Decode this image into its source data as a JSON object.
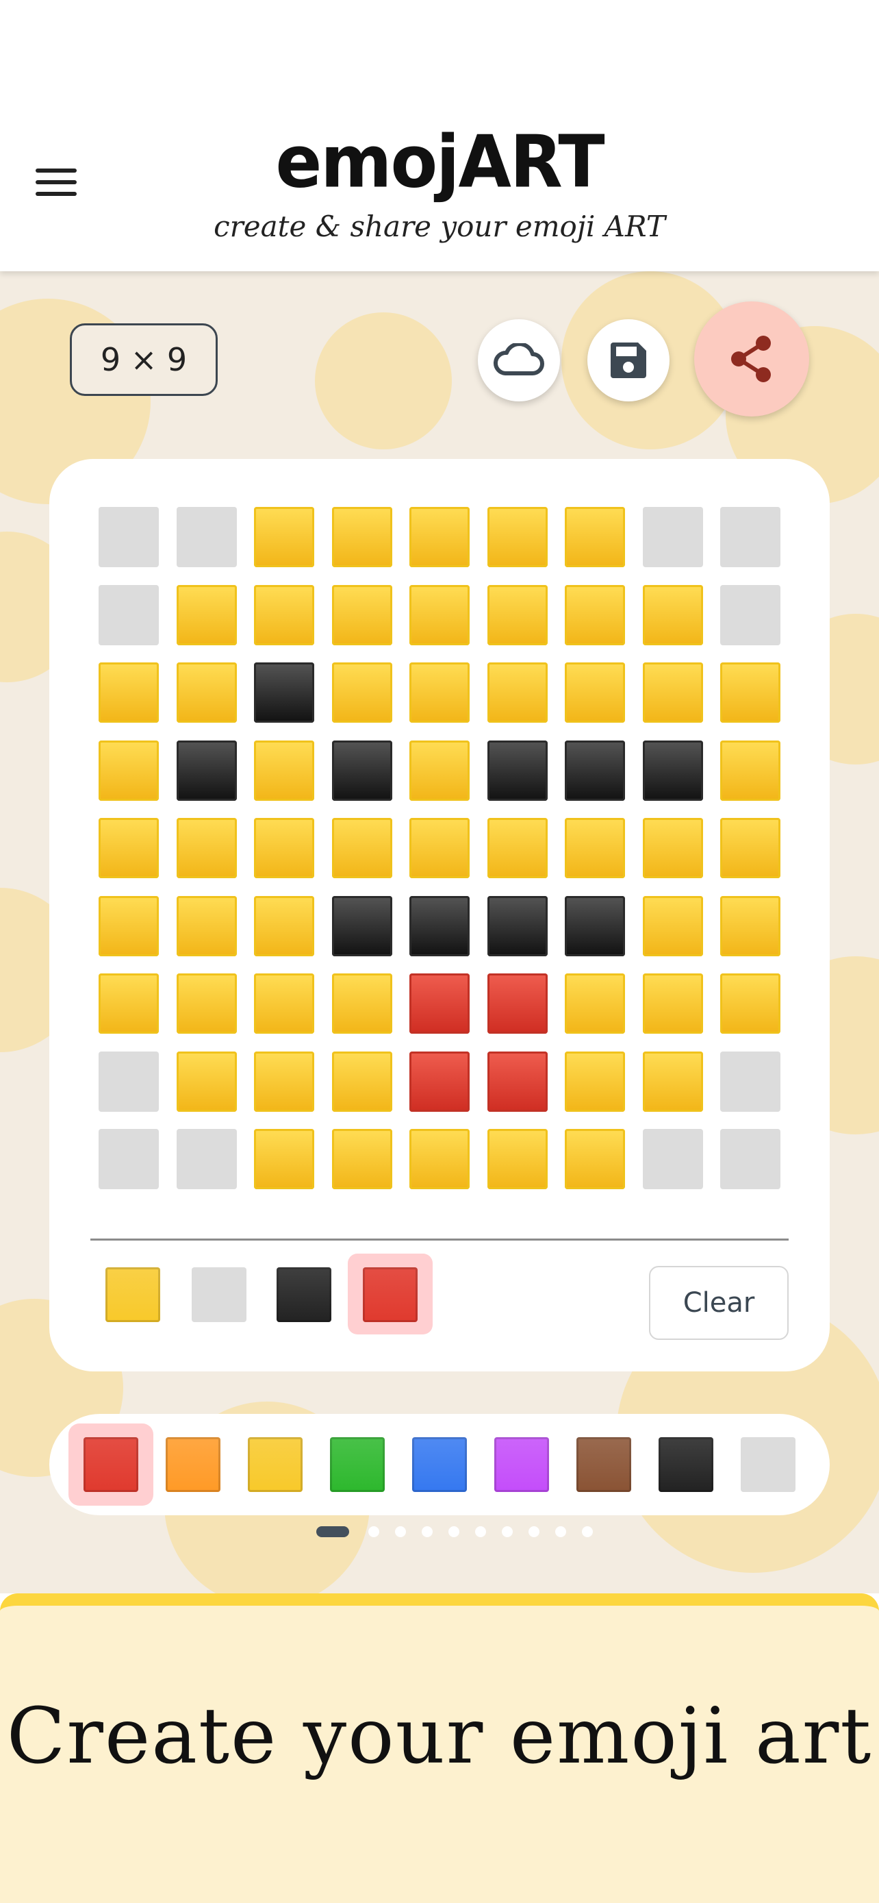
{
  "header": {
    "title": "emojART",
    "subtitle": "create & share your emoji ART"
  },
  "toolbar": {
    "grid_size": "9 × 9"
  },
  "icons": {
    "menu": "hamburger-menu-icon",
    "cloud": "cloud-icon",
    "save": "floppy-disk-icon",
    "share": "share-icon"
  },
  "colors": {
    "yellow": "#f8c92a",
    "gray": "#dcdcdc",
    "black": "#222222",
    "red": "#e03a2e",
    "orange": "#ff9a26",
    "green": "#2db82d",
    "blue": "#3578f0",
    "purple": "#c44dfa",
    "brown": "#8a5334",
    "accent_share": "#fccbc0",
    "selection": "#ffcfd1",
    "banner_bg": "#fdf1cf",
    "banner_border": "#fcd63f"
  },
  "grid": {
    "rows": [
      [
        "gray",
        "gray",
        "yellow",
        "yellow",
        "yellow",
        "yellow",
        "yellow",
        "gray",
        "gray"
      ],
      [
        "gray",
        "yellow",
        "yellow",
        "yellow",
        "yellow",
        "yellow",
        "yellow",
        "yellow",
        "gray"
      ],
      [
        "yellow",
        "yellow",
        "black",
        "yellow",
        "yellow",
        "yellow",
        "yellow",
        "yellow",
        "yellow"
      ],
      [
        "yellow",
        "black",
        "yellow",
        "black",
        "yellow",
        "black",
        "black",
        "black",
        "yellow"
      ],
      [
        "yellow",
        "yellow",
        "yellow",
        "yellow",
        "yellow",
        "yellow",
        "yellow",
        "yellow",
        "yellow"
      ],
      [
        "yellow",
        "yellow",
        "yellow",
        "black",
        "black",
        "black",
        "black",
        "yellow",
        "yellow"
      ],
      [
        "yellow",
        "yellow",
        "yellow",
        "yellow",
        "red",
        "red",
        "yellow",
        "yellow",
        "yellow"
      ],
      [
        "gray",
        "yellow",
        "yellow",
        "yellow",
        "red",
        "red",
        "yellow",
        "yellow",
        "gray"
      ],
      [
        "gray",
        "gray",
        "yellow",
        "yellow",
        "yellow",
        "yellow",
        "yellow",
        "gray",
        "gray"
      ]
    ]
  },
  "used_colors": [
    "yellow",
    "gray",
    "black",
    "red"
  ],
  "used_selected": "red",
  "clear_label": "Clear",
  "palette": {
    "colors": [
      "red",
      "orange",
      "yellow",
      "green",
      "blue",
      "purple",
      "brown",
      "black",
      "gray"
    ],
    "selected": "red"
  },
  "pagination": {
    "pages": 10,
    "active": 1
  },
  "banner": {
    "text": "Create your emoji art"
  }
}
